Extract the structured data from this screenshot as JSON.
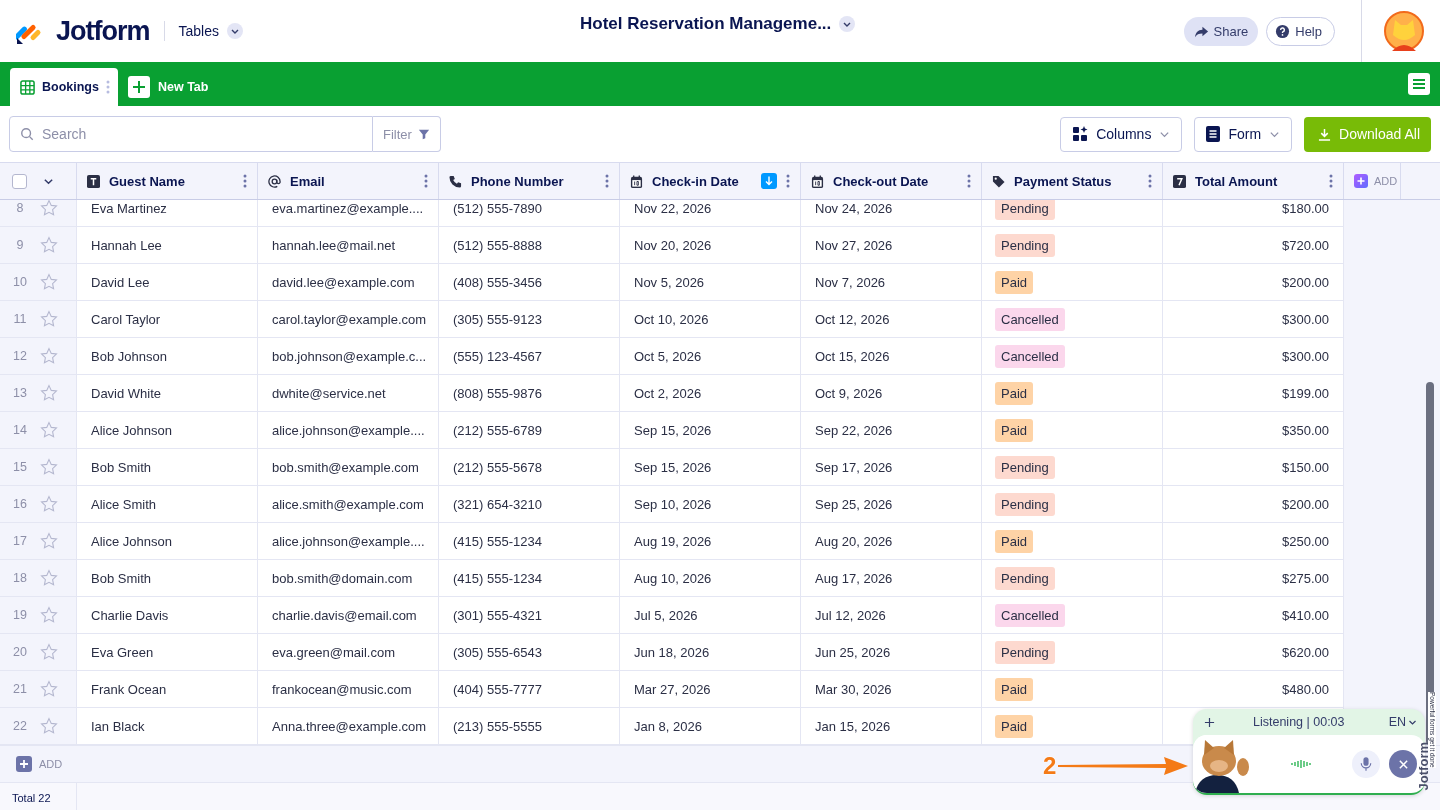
{
  "header": {
    "brand": "Jotform",
    "app_menu": "Tables",
    "title": "Hotel Reservation Manageme...",
    "share": "Share",
    "help": "Help"
  },
  "tabs": [
    {
      "label": "Bookings",
      "selected": true
    }
  ],
  "new_tab": "New Tab",
  "toolbar": {
    "search_placeholder": "Search",
    "filter": "Filter",
    "columns": "Columns",
    "form": "Form",
    "download": "Download All"
  },
  "table": {
    "columns": [
      {
        "label": "Guest Name",
        "kind": "text",
        "sorted": false
      },
      {
        "label": "Email",
        "kind": "email",
        "sorted": false
      },
      {
        "label": "Phone Number",
        "kind": "phone",
        "sorted": false
      },
      {
        "label": "Check-in Date",
        "kind": "date",
        "sorted": true
      },
      {
        "label": "Check-out Date",
        "kind": "date",
        "sorted": false
      },
      {
        "label": "Payment Status",
        "kind": "tag",
        "sorted": false
      },
      {
        "label": "Total Amount",
        "kind": "number",
        "sorted": false
      }
    ],
    "add_column": "ADD",
    "select_all_checked": false,
    "rows": [
      {
        "num": "8",
        "starred": false,
        "name": "Eva Martinez",
        "email": "eva.martinez@example....",
        "phone": "(512) 555-7890",
        "checkin": "Nov 22, 2026",
        "checkout": "Nov 24, 2026",
        "status": "Pending",
        "color": "#fdd9cf",
        "amount": "$180.00"
      },
      {
        "num": "9",
        "starred": false,
        "name": "Hannah Lee",
        "email": "hannah.lee@mail.net",
        "phone": "(512) 555-8888",
        "checkin": "Nov 20, 2026",
        "checkout": "Nov 27, 2026",
        "status": "Pending",
        "color": "#fdd9cf",
        "amount": "$720.00"
      },
      {
        "num": "10",
        "starred": false,
        "name": "David Lee",
        "email": "david.lee@example.com",
        "phone": "(408) 555-3456",
        "checkin": "Nov 5, 2026",
        "checkout": "Nov 7, 2026",
        "status": "Paid",
        "color": "#fed3a6",
        "amount": "$200.00"
      },
      {
        "num": "11",
        "starred": false,
        "name": "Carol Taylor",
        "email": "carol.taylor@example.com",
        "phone": "(305) 555-9123",
        "checkin": "Oct 10, 2026",
        "checkout": "Oct 12, 2026",
        "status": "Cancelled",
        "color": "#fbd7ec",
        "amount": "$300.00"
      },
      {
        "num": "12",
        "starred": false,
        "name": "Bob Johnson",
        "email": "bob.johnson@example.c...",
        "phone": "(555) 123-4567",
        "checkin": "Oct 5, 2026",
        "checkout": "Oct 15, 2026",
        "status": "Cancelled",
        "color": "#fbd7ec",
        "amount": "$300.00"
      },
      {
        "num": "13",
        "starred": false,
        "name": "David White",
        "email": "dwhite@service.net",
        "phone": "(808) 555-9876",
        "checkin": "Oct 2, 2026",
        "checkout": "Oct 9, 2026",
        "status": "Paid",
        "color": "#fed3a6",
        "amount": "$199.00"
      },
      {
        "num": "14",
        "starred": false,
        "name": "Alice Johnson",
        "email": "alice.johnson@example....",
        "phone": "(212) 555-6789",
        "checkin": "Sep 15, 2026",
        "checkout": "Sep 22, 2026",
        "status": "Paid",
        "color": "#fed3a6",
        "amount": "$350.00"
      },
      {
        "num": "15",
        "starred": false,
        "name": "Bob Smith",
        "email": "bob.smith@example.com",
        "phone": "(212) 555-5678",
        "checkin": "Sep 15, 2026",
        "checkout": "Sep 17, 2026",
        "status": "Pending",
        "color": "#fdd9cf",
        "amount": "$150.00"
      },
      {
        "num": "16",
        "starred": false,
        "name": "Alice Smith",
        "email": "alice.smith@example.com",
        "phone": "(321) 654-3210",
        "checkin": "Sep 10, 2026",
        "checkout": "Sep 25, 2026",
        "status": "Pending",
        "color": "#fdd9cf",
        "amount": "$200.00"
      },
      {
        "num": "17",
        "starred": false,
        "name": "Alice Johnson",
        "email": "alice.johnson@example....",
        "phone": "(415) 555-1234",
        "checkin": "Aug 19, 2026",
        "checkout": "Aug 20, 2026",
        "status": "Paid",
        "color": "#fed3a6",
        "amount": "$250.00"
      },
      {
        "num": "18",
        "starred": false,
        "name": "Bob Smith",
        "email": "bob.smith@domain.com",
        "phone": "(415) 555-1234",
        "checkin": "Aug 10, 2026",
        "checkout": "Aug 17, 2026",
        "status": "Pending",
        "color": "#fdd9cf",
        "amount": "$275.00"
      },
      {
        "num": "19",
        "starred": false,
        "name": "Charlie Davis",
        "email": "charlie.davis@email.com",
        "phone": "(301) 555-4321",
        "checkin": "Jul 5, 2026",
        "checkout": "Jul 12, 2026",
        "status": "Cancelled",
        "color": "#fbd7ec",
        "amount": "$410.00"
      },
      {
        "num": "20",
        "starred": false,
        "name": "Eva Green",
        "email": "eva.green@mail.com",
        "phone": "(305) 555-6543",
        "checkin": "Jun 18, 2026",
        "checkout": "Jun 25, 2026",
        "status": "Pending",
        "color": "#fdd9cf",
        "amount": "$620.00"
      },
      {
        "num": "21",
        "starred": false,
        "name": "Frank Ocean",
        "email": "frankocean@music.com",
        "phone": "(404) 555-7777",
        "checkin": "Mar 27, 2026",
        "checkout": "Mar 30, 2026",
        "status": "Paid",
        "color": "#fed3a6",
        "amount": "$480.00"
      },
      {
        "num": "22",
        "starred": false,
        "name": "Ian Black",
        "email": "Anna.three@example.com",
        "phone": "(213) 555-5555",
        "checkin": "Jan 8, 2026",
        "checkout": "Jan 15, 2026",
        "status": "Paid",
        "color": "#fed3a6"
      }
    ],
    "add_row": "ADD",
    "total_label": "Total",
    "total_count": "22"
  },
  "assistant": {
    "status": "Listening | 00:03",
    "language": "EN",
    "brand": "Jotform",
    "tagline": "Powerful forms get it done"
  },
  "callout": {
    "label": "2"
  }
}
